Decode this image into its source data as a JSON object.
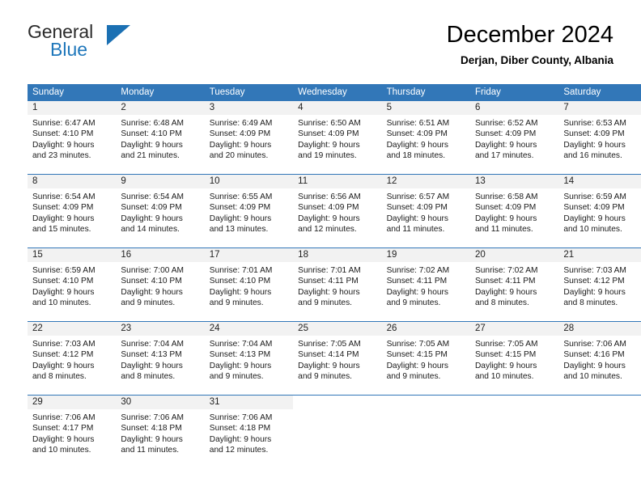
{
  "brand": {
    "word_one": "General",
    "word_two": "Blue",
    "accent_color": "#1b70b3",
    "triangle_icon": "triangle-icon"
  },
  "header": {
    "title": "December 2024",
    "subtitle": "Derjan, Diber County, Albania"
  },
  "calendar": {
    "header_bg": "#3277b8",
    "daynum_bg": "#f2f2f2",
    "weekday_headers": [
      "Sunday",
      "Monday",
      "Tuesday",
      "Wednesday",
      "Thursday",
      "Friday",
      "Saturday"
    ],
    "weeks": [
      [
        {
          "day": "1",
          "lines": [
            "Sunrise: 6:47 AM",
            "Sunset: 4:10 PM",
            "Daylight: 9 hours",
            "and 23 minutes."
          ]
        },
        {
          "day": "2",
          "lines": [
            "Sunrise: 6:48 AM",
            "Sunset: 4:10 PM",
            "Daylight: 9 hours",
            "and 21 minutes."
          ]
        },
        {
          "day": "3",
          "lines": [
            "Sunrise: 6:49 AM",
            "Sunset: 4:09 PM",
            "Daylight: 9 hours",
            "and 20 minutes."
          ]
        },
        {
          "day": "4",
          "lines": [
            "Sunrise: 6:50 AM",
            "Sunset: 4:09 PM",
            "Daylight: 9 hours",
            "and 19 minutes."
          ]
        },
        {
          "day": "5",
          "lines": [
            "Sunrise: 6:51 AM",
            "Sunset: 4:09 PM",
            "Daylight: 9 hours",
            "and 18 minutes."
          ]
        },
        {
          "day": "6",
          "lines": [
            "Sunrise: 6:52 AM",
            "Sunset: 4:09 PM",
            "Daylight: 9 hours",
            "and 17 minutes."
          ]
        },
        {
          "day": "7",
          "lines": [
            "Sunrise: 6:53 AM",
            "Sunset: 4:09 PM",
            "Daylight: 9 hours",
            "and 16 minutes."
          ]
        }
      ],
      [
        {
          "day": "8",
          "lines": [
            "Sunrise: 6:54 AM",
            "Sunset: 4:09 PM",
            "Daylight: 9 hours",
            "and 15 minutes."
          ]
        },
        {
          "day": "9",
          "lines": [
            "Sunrise: 6:54 AM",
            "Sunset: 4:09 PM",
            "Daylight: 9 hours",
            "and 14 minutes."
          ]
        },
        {
          "day": "10",
          "lines": [
            "Sunrise: 6:55 AM",
            "Sunset: 4:09 PM",
            "Daylight: 9 hours",
            "and 13 minutes."
          ]
        },
        {
          "day": "11",
          "lines": [
            "Sunrise: 6:56 AM",
            "Sunset: 4:09 PM",
            "Daylight: 9 hours",
            "and 12 minutes."
          ]
        },
        {
          "day": "12",
          "lines": [
            "Sunrise: 6:57 AM",
            "Sunset: 4:09 PM",
            "Daylight: 9 hours",
            "and 11 minutes."
          ]
        },
        {
          "day": "13",
          "lines": [
            "Sunrise: 6:58 AM",
            "Sunset: 4:09 PM",
            "Daylight: 9 hours",
            "and 11 minutes."
          ]
        },
        {
          "day": "14",
          "lines": [
            "Sunrise: 6:59 AM",
            "Sunset: 4:09 PM",
            "Daylight: 9 hours",
            "and 10 minutes."
          ]
        }
      ],
      [
        {
          "day": "15",
          "lines": [
            "Sunrise: 6:59 AM",
            "Sunset: 4:10 PM",
            "Daylight: 9 hours",
            "and 10 minutes."
          ]
        },
        {
          "day": "16",
          "lines": [
            "Sunrise: 7:00 AM",
            "Sunset: 4:10 PM",
            "Daylight: 9 hours",
            "and 9 minutes."
          ]
        },
        {
          "day": "17",
          "lines": [
            "Sunrise: 7:01 AM",
            "Sunset: 4:10 PM",
            "Daylight: 9 hours",
            "and 9 minutes."
          ]
        },
        {
          "day": "18",
          "lines": [
            "Sunrise: 7:01 AM",
            "Sunset: 4:11 PM",
            "Daylight: 9 hours",
            "and 9 minutes."
          ]
        },
        {
          "day": "19",
          "lines": [
            "Sunrise: 7:02 AM",
            "Sunset: 4:11 PM",
            "Daylight: 9 hours",
            "and 9 minutes."
          ]
        },
        {
          "day": "20",
          "lines": [
            "Sunrise: 7:02 AM",
            "Sunset: 4:11 PM",
            "Daylight: 9 hours",
            "and 8 minutes."
          ]
        },
        {
          "day": "21",
          "lines": [
            "Sunrise: 7:03 AM",
            "Sunset: 4:12 PM",
            "Daylight: 9 hours",
            "and 8 minutes."
          ]
        }
      ],
      [
        {
          "day": "22",
          "lines": [
            "Sunrise: 7:03 AM",
            "Sunset: 4:12 PM",
            "Daylight: 9 hours",
            "and 8 minutes."
          ]
        },
        {
          "day": "23",
          "lines": [
            "Sunrise: 7:04 AM",
            "Sunset: 4:13 PM",
            "Daylight: 9 hours",
            "and 8 minutes."
          ]
        },
        {
          "day": "24",
          "lines": [
            "Sunrise: 7:04 AM",
            "Sunset: 4:13 PM",
            "Daylight: 9 hours",
            "and 9 minutes."
          ]
        },
        {
          "day": "25",
          "lines": [
            "Sunrise: 7:05 AM",
            "Sunset: 4:14 PM",
            "Daylight: 9 hours",
            "and 9 minutes."
          ]
        },
        {
          "day": "26",
          "lines": [
            "Sunrise: 7:05 AM",
            "Sunset: 4:15 PM",
            "Daylight: 9 hours",
            "and 9 minutes."
          ]
        },
        {
          "day": "27",
          "lines": [
            "Sunrise: 7:05 AM",
            "Sunset: 4:15 PM",
            "Daylight: 9 hours",
            "and 10 minutes."
          ]
        },
        {
          "day": "28",
          "lines": [
            "Sunrise: 7:06 AM",
            "Sunset: 4:16 PM",
            "Daylight: 9 hours",
            "and 10 minutes."
          ]
        }
      ],
      [
        {
          "day": "29",
          "lines": [
            "Sunrise: 7:06 AM",
            "Sunset: 4:17 PM",
            "Daylight: 9 hours",
            "and 10 minutes."
          ]
        },
        {
          "day": "30",
          "lines": [
            "Sunrise: 7:06 AM",
            "Sunset: 4:18 PM",
            "Daylight: 9 hours",
            "and 11 minutes."
          ]
        },
        {
          "day": "31",
          "lines": [
            "Sunrise: 7:06 AM",
            "Sunset: 4:18 PM",
            "Daylight: 9 hours",
            "and 12 minutes."
          ]
        },
        {
          "day": "",
          "lines": []
        },
        {
          "day": "",
          "lines": []
        },
        {
          "day": "",
          "lines": []
        },
        {
          "day": "",
          "lines": []
        }
      ]
    ]
  }
}
